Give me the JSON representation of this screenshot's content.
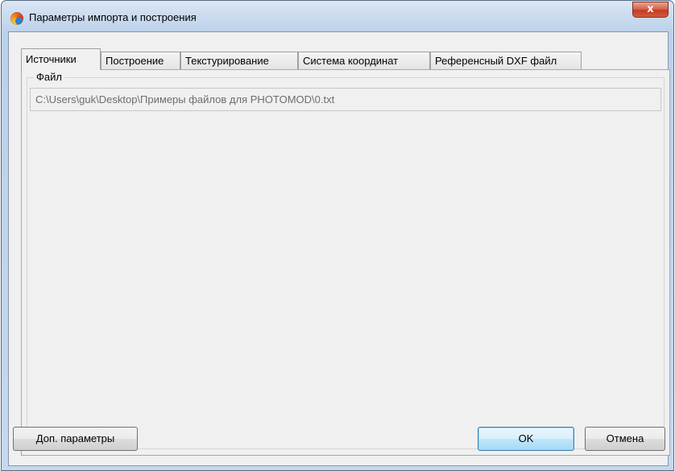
{
  "window": {
    "title": "Параметры импорта и построения",
    "close_label": "x"
  },
  "tabs": [
    {
      "label": "Источники",
      "active": true
    },
    {
      "label": "Построение",
      "active": false
    },
    {
      "label": "Текстурирование",
      "active": false
    },
    {
      "label": "Система координат",
      "active": false
    },
    {
      "label": "Референсный DXF файл",
      "active": false
    }
  ],
  "sources": {
    "group_label": "Файл",
    "file_path": "C:\\Users\\guk\\Desktop\\Примеры файлов для PHOTOMOD\\0.txt"
  },
  "buttons": {
    "extra_params": "Доп. параметры",
    "ok": "OK",
    "cancel": "Отмена"
  },
  "icons": {
    "app": "photomod-app-icon",
    "close": "close-icon"
  }
}
